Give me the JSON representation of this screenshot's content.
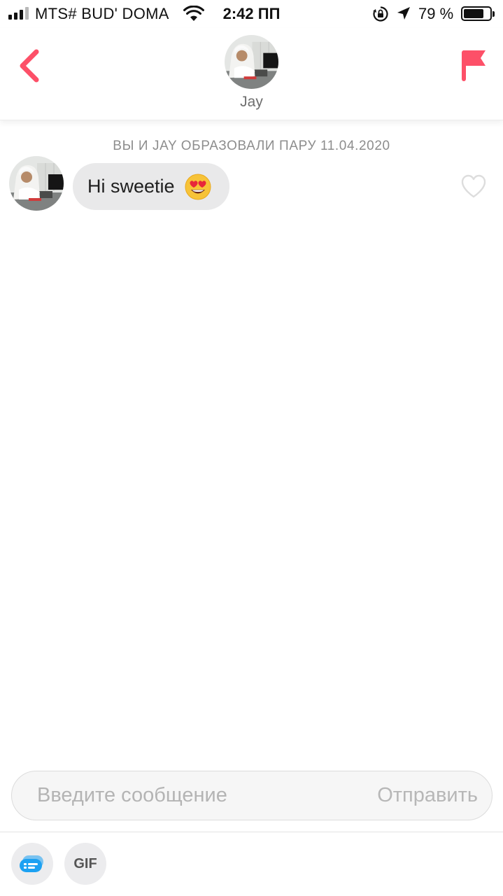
{
  "status_bar": {
    "carrier": "MTS# BUD' DOMA",
    "time": "2:42 ПП",
    "battery_percent": "79 %",
    "battery_level": 0.79,
    "signal_bars": 3
  },
  "header": {
    "contact_name": "Jay",
    "accent_color": "#fd5068"
  },
  "chat": {
    "match_note": "ВЫ И JAY ОБРАЗОВАЛИ ПАРУ 11.04.2020",
    "messages": [
      {
        "text": "Hi sweetie",
        "emoji": "heart-eyes-emoji"
      }
    ]
  },
  "composer": {
    "placeholder": "Введите сообщение",
    "send_label": "Отправить",
    "gif_label": "GIF"
  },
  "icons": [
    "back-chevron-icon",
    "flag-icon",
    "heart-icon",
    "wifi-icon",
    "rotation-lock-icon",
    "location-arrow-icon",
    "sticker-icon"
  ]
}
